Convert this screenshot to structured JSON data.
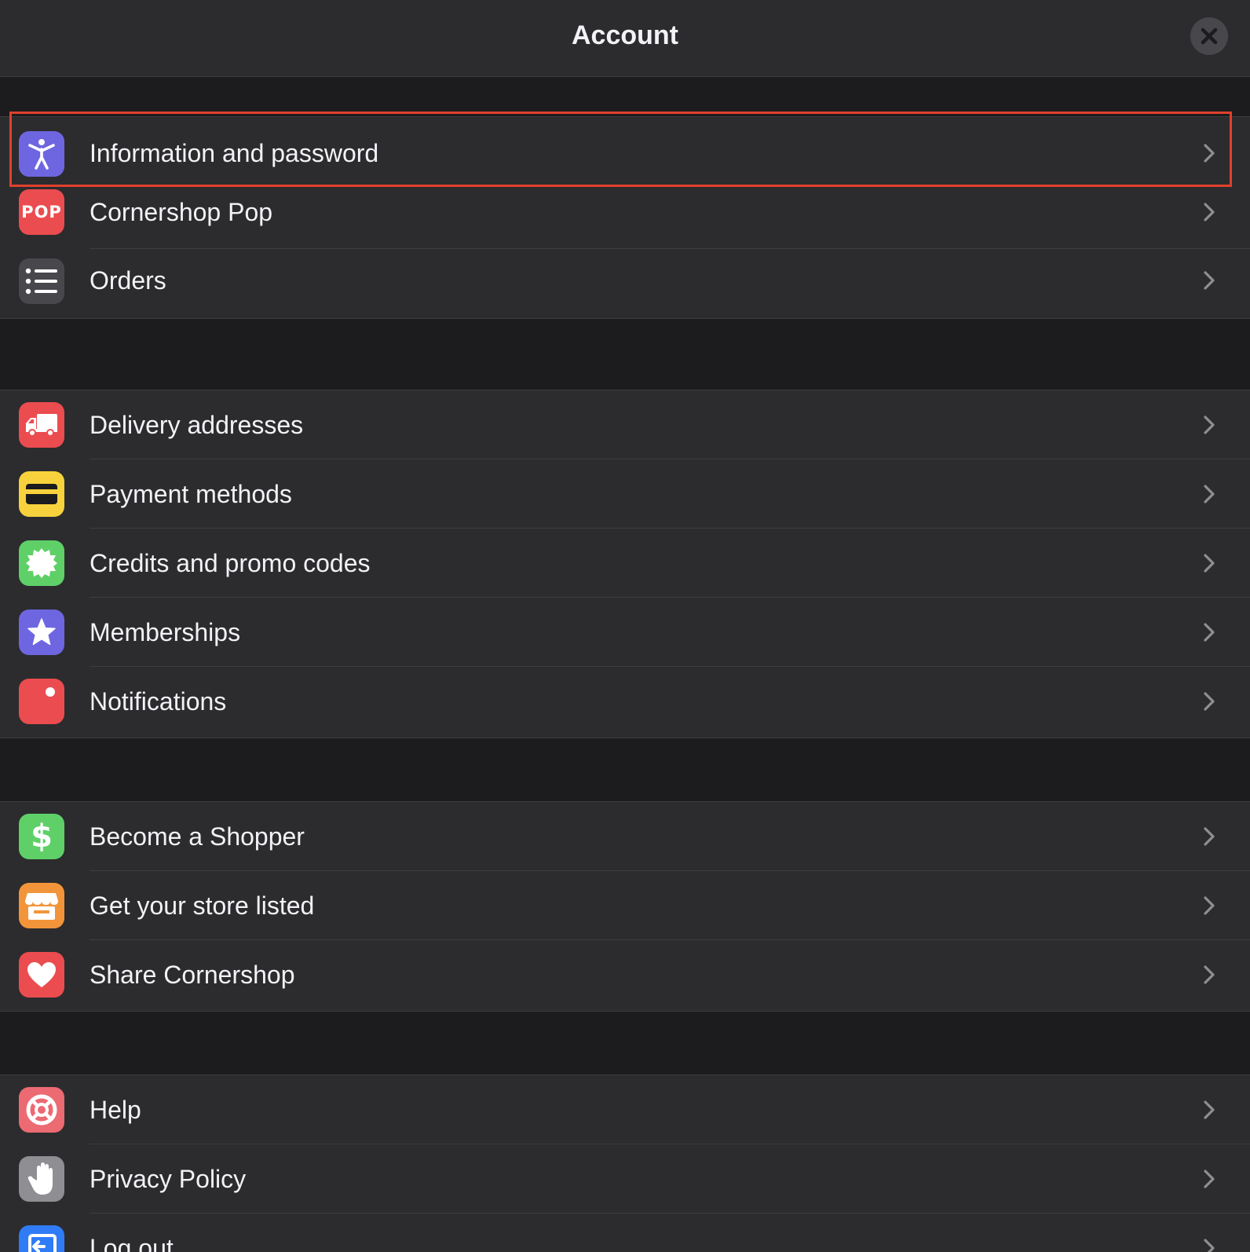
{
  "header": {
    "title": "Account",
    "close_icon": "close-icon"
  },
  "sections": [
    {
      "items": [
        {
          "label": "Information and password",
          "icon": "accessibility-person-icon",
          "color": "#6e66e0",
          "highlighted": true
        },
        {
          "label": "Cornershop Pop",
          "icon": "pop-icon",
          "icon_text": "POP",
          "color": "#eb4c4f"
        },
        {
          "label": "Orders",
          "icon": "list-icon",
          "color": "#48484c"
        }
      ]
    },
    {
      "items": [
        {
          "label": "Delivery addresses",
          "icon": "truck-icon",
          "color": "#eb4c4f"
        },
        {
          "label": "Payment methods",
          "icon": "credit-card-icon",
          "color": "#f7d23c"
        },
        {
          "label": "Credits and promo codes",
          "icon": "badge-icon",
          "color": "#5fd068"
        },
        {
          "label": "Memberships",
          "icon": "star-icon",
          "color": "#6e66e0"
        },
        {
          "label": "Notifications",
          "icon": "notification-icon",
          "color": "#eb4c4f"
        }
      ]
    },
    {
      "items": [
        {
          "label": "Become a Shopper",
          "icon": "dollar-icon",
          "icon_text": "$",
          "color": "#5fd068"
        },
        {
          "label": "Get your store listed",
          "icon": "storefront-icon",
          "color": "#f2953a"
        },
        {
          "label": "Share Cornershop",
          "icon": "heart-icon",
          "color": "#eb4c4f"
        }
      ]
    },
    {
      "items": [
        {
          "label": "Help",
          "icon": "lifebuoy-icon",
          "color": "#ec6a72"
        },
        {
          "label": "Privacy Policy",
          "icon": "hand-icon",
          "color": "#8e8e93"
        },
        {
          "label": "Log out",
          "icon": "logout-icon",
          "color": "#2f7cf6"
        }
      ]
    }
  ],
  "colors": {
    "background": "#1c1c1e",
    "cell": "#2c2c2e",
    "text": "#f2f2f7",
    "chevron": "#8e8e93",
    "highlight_border": "#e0412c"
  }
}
